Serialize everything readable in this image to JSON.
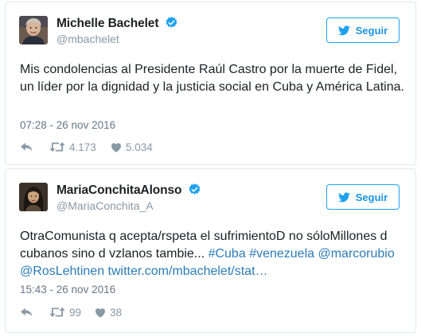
{
  "colors": {
    "accent": "#1da1f2",
    "link": "#2b7bb9",
    "muted": "#8899a6",
    "border": "#e1e8ed",
    "text": "#1c2022"
  },
  "tweets": [
    {
      "author_name": "Michelle Bachelet",
      "handle": "@mbachelet",
      "verified": true,
      "avatar_icon": "avatar-photo",
      "follow_label": "Seguir",
      "text": "Mis condolencias al Presidente Raúl Castro por la muerte de Fidel, un líder por la dignidad y la justicia social en Cuba y América Latina.",
      "timestamp": "07:28 - 26 nov 2016",
      "retweets": "4.173",
      "likes": "5.034"
    },
    {
      "author_name": "MariaConchitaAlonso",
      "handle": "@MariaConchita_A",
      "verified": true,
      "avatar_icon": "avatar-photo",
      "follow_label": "Seguir",
      "text_plain": "OtraComunista q acepta/rspeta el sufrimientoD no sóloMillones d cubanos sino d vzlanos tambie... ",
      "text_links": [
        "#Cuba",
        "#venezuela",
        "@marcorubio",
        "@RosLehtinen",
        "twitter.com/mbachelet/stat…"
      ],
      "timestamp": "15:43 - 26 nov 2016",
      "retweets": "99",
      "likes": "38"
    }
  ]
}
